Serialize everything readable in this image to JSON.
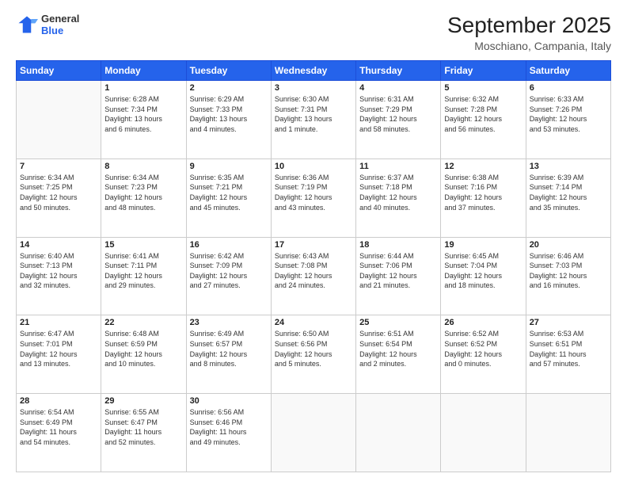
{
  "logo": {
    "line1": "General",
    "line2": "Blue"
  },
  "header": {
    "month": "September 2025",
    "location": "Moschiano, Campania, Italy"
  },
  "weekdays": [
    "Sunday",
    "Monday",
    "Tuesday",
    "Wednesday",
    "Thursday",
    "Friday",
    "Saturday"
  ],
  "weeks": [
    [
      {
        "day": "",
        "info": ""
      },
      {
        "day": "1",
        "info": "Sunrise: 6:28 AM\nSunset: 7:34 PM\nDaylight: 13 hours\nand 6 minutes."
      },
      {
        "day": "2",
        "info": "Sunrise: 6:29 AM\nSunset: 7:33 PM\nDaylight: 13 hours\nand 4 minutes."
      },
      {
        "day": "3",
        "info": "Sunrise: 6:30 AM\nSunset: 7:31 PM\nDaylight: 13 hours\nand 1 minute."
      },
      {
        "day": "4",
        "info": "Sunrise: 6:31 AM\nSunset: 7:29 PM\nDaylight: 12 hours\nand 58 minutes."
      },
      {
        "day": "5",
        "info": "Sunrise: 6:32 AM\nSunset: 7:28 PM\nDaylight: 12 hours\nand 56 minutes."
      },
      {
        "day": "6",
        "info": "Sunrise: 6:33 AM\nSunset: 7:26 PM\nDaylight: 12 hours\nand 53 minutes."
      }
    ],
    [
      {
        "day": "7",
        "info": "Sunrise: 6:34 AM\nSunset: 7:25 PM\nDaylight: 12 hours\nand 50 minutes."
      },
      {
        "day": "8",
        "info": "Sunrise: 6:34 AM\nSunset: 7:23 PM\nDaylight: 12 hours\nand 48 minutes."
      },
      {
        "day": "9",
        "info": "Sunrise: 6:35 AM\nSunset: 7:21 PM\nDaylight: 12 hours\nand 45 minutes."
      },
      {
        "day": "10",
        "info": "Sunrise: 6:36 AM\nSunset: 7:19 PM\nDaylight: 12 hours\nand 43 minutes."
      },
      {
        "day": "11",
        "info": "Sunrise: 6:37 AM\nSunset: 7:18 PM\nDaylight: 12 hours\nand 40 minutes."
      },
      {
        "day": "12",
        "info": "Sunrise: 6:38 AM\nSunset: 7:16 PM\nDaylight: 12 hours\nand 37 minutes."
      },
      {
        "day": "13",
        "info": "Sunrise: 6:39 AM\nSunset: 7:14 PM\nDaylight: 12 hours\nand 35 minutes."
      }
    ],
    [
      {
        "day": "14",
        "info": "Sunrise: 6:40 AM\nSunset: 7:13 PM\nDaylight: 12 hours\nand 32 minutes."
      },
      {
        "day": "15",
        "info": "Sunrise: 6:41 AM\nSunset: 7:11 PM\nDaylight: 12 hours\nand 29 minutes."
      },
      {
        "day": "16",
        "info": "Sunrise: 6:42 AM\nSunset: 7:09 PM\nDaylight: 12 hours\nand 27 minutes."
      },
      {
        "day": "17",
        "info": "Sunrise: 6:43 AM\nSunset: 7:08 PM\nDaylight: 12 hours\nand 24 minutes."
      },
      {
        "day": "18",
        "info": "Sunrise: 6:44 AM\nSunset: 7:06 PM\nDaylight: 12 hours\nand 21 minutes."
      },
      {
        "day": "19",
        "info": "Sunrise: 6:45 AM\nSunset: 7:04 PM\nDaylight: 12 hours\nand 18 minutes."
      },
      {
        "day": "20",
        "info": "Sunrise: 6:46 AM\nSunset: 7:03 PM\nDaylight: 12 hours\nand 16 minutes."
      }
    ],
    [
      {
        "day": "21",
        "info": "Sunrise: 6:47 AM\nSunset: 7:01 PM\nDaylight: 12 hours\nand 13 minutes."
      },
      {
        "day": "22",
        "info": "Sunrise: 6:48 AM\nSunset: 6:59 PM\nDaylight: 12 hours\nand 10 minutes."
      },
      {
        "day": "23",
        "info": "Sunrise: 6:49 AM\nSunset: 6:57 PM\nDaylight: 12 hours\nand 8 minutes."
      },
      {
        "day": "24",
        "info": "Sunrise: 6:50 AM\nSunset: 6:56 PM\nDaylight: 12 hours\nand 5 minutes."
      },
      {
        "day": "25",
        "info": "Sunrise: 6:51 AM\nSunset: 6:54 PM\nDaylight: 12 hours\nand 2 minutes."
      },
      {
        "day": "26",
        "info": "Sunrise: 6:52 AM\nSunset: 6:52 PM\nDaylight: 12 hours\nand 0 minutes."
      },
      {
        "day": "27",
        "info": "Sunrise: 6:53 AM\nSunset: 6:51 PM\nDaylight: 11 hours\nand 57 minutes."
      }
    ],
    [
      {
        "day": "28",
        "info": "Sunrise: 6:54 AM\nSunset: 6:49 PM\nDaylight: 11 hours\nand 54 minutes."
      },
      {
        "day": "29",
        "info": "Sunrise: 6:55 AM\nSunset: 6:47 PM\nDaylight: 11 hours\nand 52 minutes."
      },
      {
        "day": "30",
        "info": "Sunrise: 6:56 AM\nSunset: 6:46 PM\nDaylight: 11 hours\nand 49 minutes."
      },
      {
        "day": "",
        "info": ""
      },
      {
        "day": "",
        "info": ""
      },
      {
        "day": "",
        "info": ""
      },
      {
        "day": "",
        "info": ""
      }
    ]
  ]
}
